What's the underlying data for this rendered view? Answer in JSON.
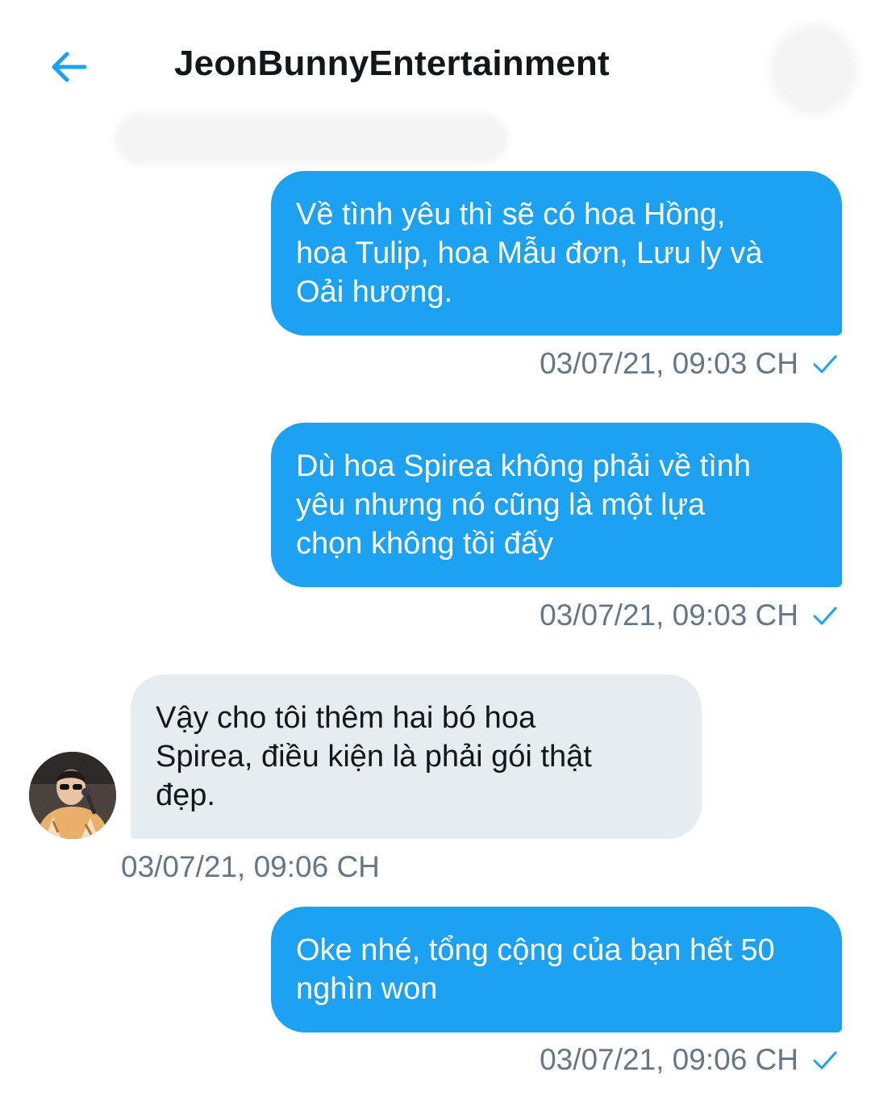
{
  "header": {
    "title": "JeonBunnyEntertainment",
    "back_icon": "arrow-left-icon",
    "accent": "#1da1f2"
  },
  "colors": {
    "outgoing_bubble": "#1da1f2",
    "incoming_bubble": "#e6ecf0",
    "timestamp": "#657786"
  },
  "messages": [
    {
      "direction": "outgoing",
      "text": "Về tình yêu thì sẽ có hoa Hồng,\nhoa Tulip, hoa Mẫu đơn, Lưu ly và\nOải hương.",
      "time": "03/07/21, 09:03 CH",
      "status_icon": "check-icon"
    },
    {
      "direction": "outgoing",
      "text": "Dù hoa Spirea không phải về tình\nyêu nhưng nó cũng là một lựa\nchọn không tồi đấy",
      "time": "03/07/21, 09:03 CH",
      "status_icon": "check-icon"
    },
    {
      "direction": "incoming",
      "text": "Vậy cho tôi thêm hai bó hoa\nSpirea, điều kiện là phải gói thật\nđẹp.",
      "time": "03/07/21, 09:06 CH",
      "avatar_icon": "avatar-icon"
    },
    {
      "direction": "outgoing",
      "text": "Oke nhé, tổng cộng của bạn hết 50\nnghìn won",
      "time": "03/07/21, 09:06 CH",
      "status_icon": "check-icon"
    }
  ]
}
